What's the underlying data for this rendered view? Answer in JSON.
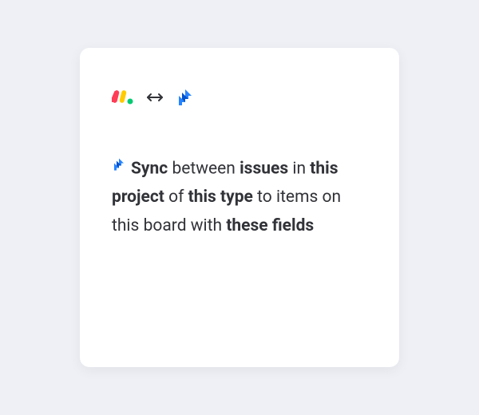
{
  "sync": {
    "action": "Sync",
    "between": "between",
    "issues": "issues",
    "in": "in",
    "this_project": "this project",
    "of": "of",
    "this_type": "this type",
    "to_items": "to items",
    "on_board": "on this board with",
    "these_fields": "these fields"
  }
}
